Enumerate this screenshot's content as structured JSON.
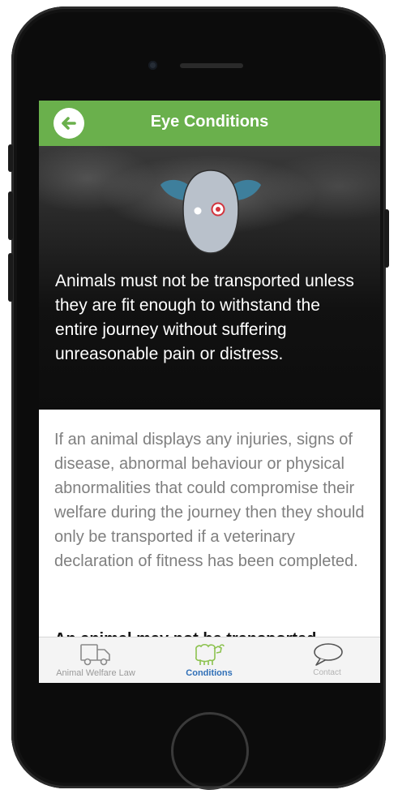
{
  "header": {
    "title": "Eye Conditions"
  },
  "hero": {
    "text": "Animals must not be transported unless they are fit enough to withstand the entire journey without suffering unreasonable pain or distress."
  },
  "content": {
    "paragraph": "If an animal displays any injuries, signs of disease, abnormal behaviour or physical abnormalities that could compromise their welfare during the journey then they should only be transported if a veterinary declaration of fitness has been completed.",
    "bold_heading": "An animal may not be transported"
  },
  "tabbar": {
    "tabs": [
      {
        "label": "Animal Welfare Law",
        "icon": "truck-icon",
        "selected": false
      },
      {
        "label": "Conditions",
        "icon": "sheep-icon",
        "selected": true
      },
      {
        "label": "Contact",
        "icon": "speech-bubble-icon",
        "selected": false
      }
    ]
  },
  "colors": {
    "header": "#6ab04c",
    "active_tab": "#2f6fb7",
    "sheep_face": "#b9c1cb",
    "sheep_ears": "#3e7f9c"
  },
  "icons": {
    "back": "back-arrow-icon",
    "hero": "sheep-face-icon"
  }
}
